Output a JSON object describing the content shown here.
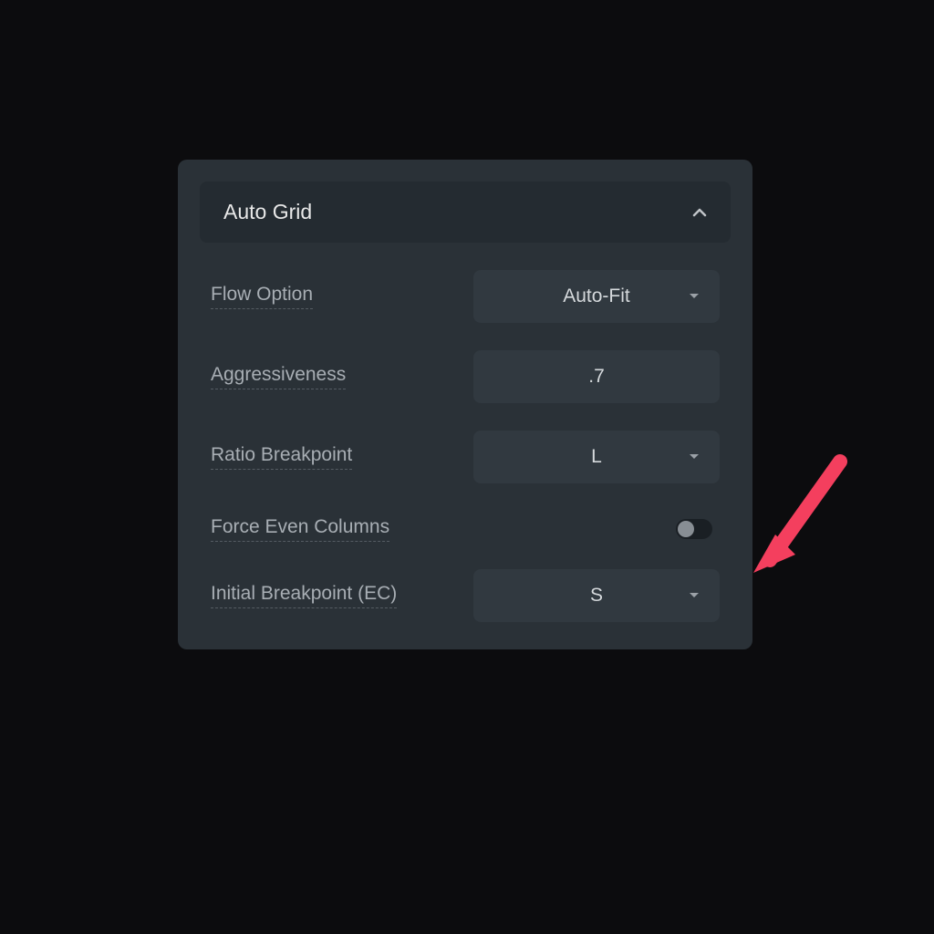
{
  "panel": {
    "section_title": "Auto Grid",
    "rows": {
      "flow_option": {
        "label": "Flow Option",
        "value": "Auto-Fit"
      },
      "aggressiveness": {
        "label": "Aggressiveness",
        "value": ".7"
      },
      "ratio_breakpoint": {
        "label": "Ratio Breakpoint",
        "value": "L"
      },
      "force_even_columns": {
        "label": "Force Even Columns",
        "on": false
      },
      "initial_breakpoint_ec": {
        "label": "Initial Breakpoint (EC)",
        "value": "S"
      }
    }
  },
  "colors": {
    "annotation_arrow": "#f43f5e"
  }
}
